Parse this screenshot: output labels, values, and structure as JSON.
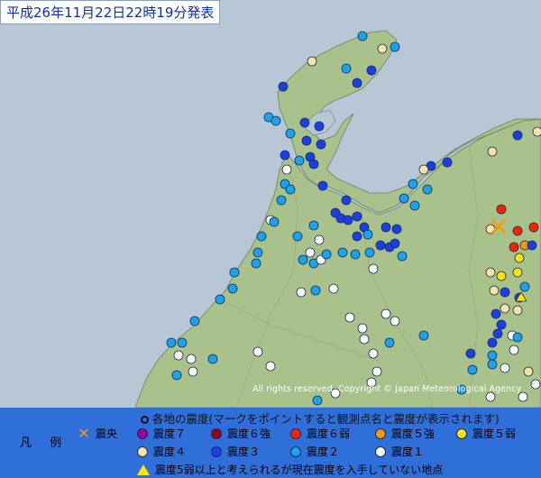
{
  "header": {
    "timestamp": "平成26年11月22日22時19分発表"
  },
  "map": {
    "copyright": "All rights reserved. Copyright © Japan Meteorological Agency",
    "colors": {
      "sea": "#b7c7d6",
      "land": "#a9c18a",
      "shindo7": "#a0009a",
      "shindo6plus": "#9a0016",
      "shindo6minus": "#ff2000",
      "shindo5plus": "#ff9a00",
      "shindo5minus": "#ffe600",
      "shindo4": "#f6e3a5",
      "shindo3": "#1a3ee8",
      "shindo2": "#1aa3f0",
      "shindo1": "#ffffff"
    }
  },
  "legend": {
    "label": "凡 例",
    "title": "各地の震度(マークをポイントすると観測点名と震度が表示されます)",
    "items": [
      {
        "key": "epicenter",
        "label": "震央"
      },
      {
        "key": "shindo7",
        "label": "震度７"
      },
      {
        "key": "shindo6plus",
        "label": "震度６強"
      },
      {
        "key": "shindo6minus",
        "label": "震度６弱"
      },
      {
        "key": "shindo5plus",
        "label": "震度５強"
      },
      {
        "key": "shindo5minus",
        "label": "震度５弱"
      },
      {
        "key": "shindo4",
        "label": "震度４"
      },
      {
        "key": "shindo3",
        "label": "震度３"
      },
      {
        "key": "shindo2",
        "label": "震度２"
      },
      {
        "key": "shindo1",
        "label": "震度１"
      },
      {
        "key": "unknown",
        "label": "震度5弱以上と考えられるが現在震度を入手していない地点"
      }
    ]
  }
}
